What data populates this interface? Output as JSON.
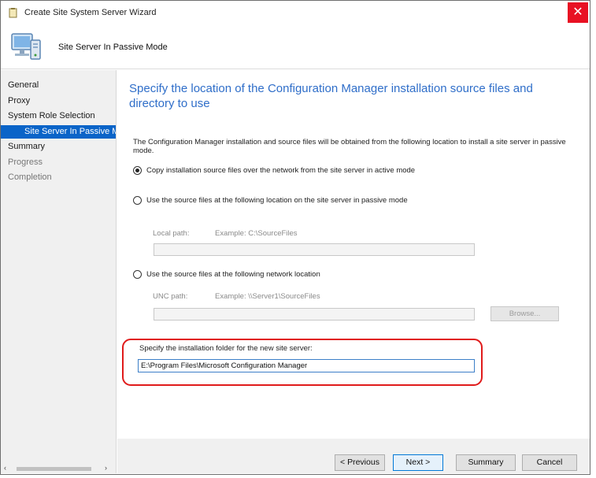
{
  "window": {
    "title": "Create Site System Server Wizard",
    "close_glyph": "✕"
  },
  "header": {
    "page_name": "Site Server In Passive Mode"
  },
  "sidebar": {
    "items": [
      {
        "label": "General",
        "state": "normal"
      },
      {
        "label": "Proxy",
        "state": "normal"
      },
      {
        "label": "System Role Selection",
        "state": "normal"
      },
      {
        "label": "Site Server In Passive Mo",
        "state": "selected"
      },
      {
        "label": "Summary",
        "state": "normal"
      },
      {
        "label": "Progress",
        "state": "disabled"
      },
      {
        "label": "Completion",
        "state": "disabled"
      }
    ],
    "scroll_left": "‹",
    "scroll_right": "›"
  },
  "main": {
    "title": "Specify the location of the Configuration Manager installation source files and directory to use",
    "description": "The Configuration Manager installation and source files will be obtained from the following location to install a site server in passive mode.",
    "option_network": "Copy installation source files over the network from the site server in active mode",
    "option_local": "Use the source files at the following location on the site server in passive mode",
    "local_path_label": "Local path:",
    "local_path_example": "Example: C:\\SourceFiles",
    "local_path_value": "",
    "option_unc": "Use the source files at the following network location",
    "unc_path_label": "UNC path:",
    "unc_path_example": "Example: \\\\Server1\\SourceFiles",
    "unc_path_value": "",
    "browse_label": "Browse...",
    "install_folder_label": "Specify the installation folder for the new site server:",
    "install_folder_value": "E:\\Program Files\\Microsoft Configuration Manager"
  },
  "footer": {
    "previous_label": "< Previous",
    "next_label": "Next >",
    "summary_label": "Summary",
    "cancel_label": "Cancel"
  },
  "colors": {
    "accent": "#2f6ec9",
    "selected_nav": "#0a64c8",
    "close": "#e81123",
    "highlight": "#e01b1b"
  }
}
